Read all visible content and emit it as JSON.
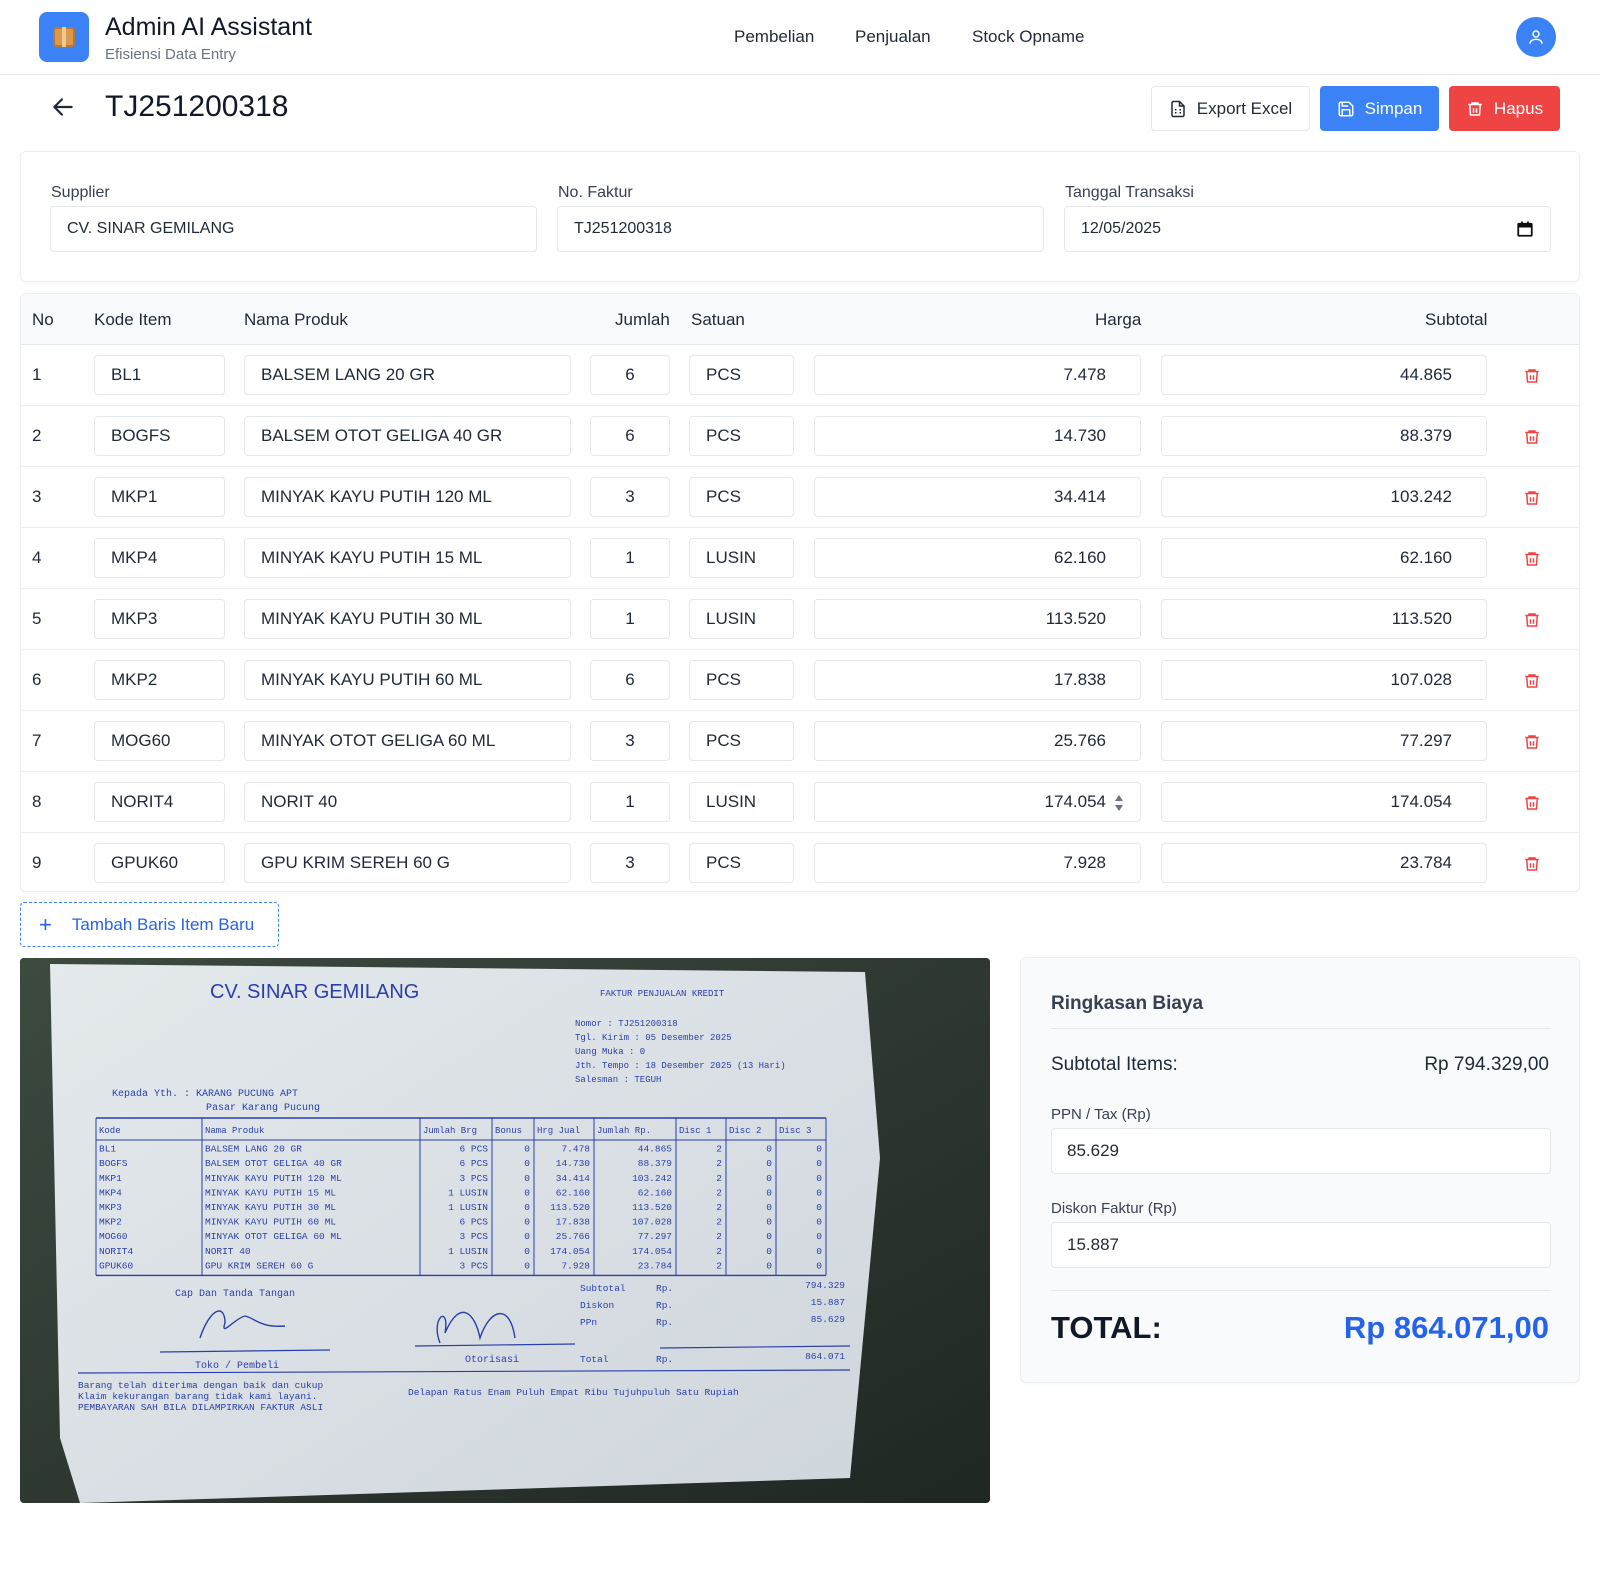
{
  "header": {
    "app_title": "Admin AI Assistant",
    "app_subtitle": "Efisiensi Data Entry",
    "nav": [
      "Pembelian",
      "Penjualan",
      "Stock Opname"
    ]
  },
  "page": {
    "title": "TJ251200318",
    "export_label": "Export Excel",
    "save_label": "Simpan",
    "delete_label": "Hapus"
  },
  "form": {
    "supplier_label": "Supplier",
    "supplier_value": "CV. SINAR GEMILANG",
    "faktur_label": "No. Faktur",
    "faktur_value": "TJ251200318",
    "tanggal_label": "Tanggal Transaksi",
    "tanggal_value": "12/05/2025"
  },
  "table": {
    "headers": {
      "no": "No",
      "kode": "Kode Item",
      "nama": "Nama Produk",
      "jumlah": "Jumlah",
      "satuan": "Satuan",
      "harga": "Harga",
      "subtotal": "Subtotal"
    },
    "rows": [
      {
        "no": "1",
        "kode": "BL1",
        "nama": "BALSEM LANG 20 GR",
        "jumlah": "6",
        "satuan": "PCS",
        "harga": "7.478",
        "subtotal": "44.865"
      },
      {
        "no": "2",
        "kode": "BOGFS",
        "nama": "BALSEM OTOT GELIGA 40 GR",
        "jumlah": "6",
        "satuan": "PCS",
        "harga": "14.730",
        "subtotal": "88.379"
      },
      {
        "no": "3",
        "kode": "MKP1",
        "nama": "MINYAK KAYU PUTIH 120 ML",
        "jumlah": "3",
        "satuan": "PCS",
        "harga": "34.414",
        "subtotal": "103.242"
      },
      {
        "no": "4",
        "kode": "MKP4",
        "nama": "MINYAK KAYU PUTIH 15 ML",
        "jumlah": "1",
        "satuan": "LUSIN",
        "harga": "62.160",
        "subtotal": "62.160"
      },
      {
        "no": "5",
        "kode": "MKP3",
        "nama": "MINYAK KAYU PUTIH 30 ML",
        "jumlah": "1",
        "satuan": "LUSIN",
        "harga": "113.520",
        "subtotal": "113.520"
      },
      {
        "no": "6",
        "kode": "MKP2",
        "nama": "MINYAK KAYU PUTIH 60 ML",
        "jumlah": "6",
        "satuan": "PCS",
        "harga": "17.838",
        "subtotal": "107.028"
      },
      {
        "no": "7",
        "kode": "MOG60",
        "nama": "MINYAK OTOT GELIGA 60 ML",
        "jumlah": "3",
        "satuan": "PCS",
        "harga": "25.766",
        "subtotal": "77.297"
      },
      {
        "no": "8",
        "kode": "NORIT4",
        "nama": "NORIT 40",
        "jumlah": "1",
        "satuan": "LUSIN",
        "harga": "174.054",
        "subtotal": "174.054"
      },
      {
        "no": "9",
        "kode": "GPUK60",
        "nama": "GPU KRIM SEREH 60 G",
        "jumlah": "3",
        "satuan": "PCS",
        "harga": "7.928",
        "subtotal": "23.784"
      }
    ],
    "add_row_label": "Tambah Baris Item Baru"
  },
  "invoice_photo": {
    "company": "CV. SINAR GEMILANG",
    "doc_type": "FAKTUR PENJUALAN KREDIT",
    "meta": [
      "Nomor : TJ251200318",
      "Tgl. Kirim : 05 Desember 2025",
      "Uang Muka : 0",
      "Jth. Tempo : 18 Desember 2025 (13 Hari)",
      "Salesman : TEGUH"
    ],
    "to_line1": "Kepada Yth. : KARANG PUCUNG APT",
    "to_line2": "Pasar Karang Pucung",
    "headers": [
      "Kode",
      "Nama Produk",
      "Jumlah Brg",
      "Bonus",
      "Hrg Jual",
      "Jumlah Rp.",
      "Disc 1",
      "Disc 2",
      "Disc 3"
    ],
    "rows": [
      [
        "BL1",
        "BALSEM LANG 20 GR",
        "6 PCS",
        "0",
        "7.478",
        "44.865",
        "2",
        "0",
        "0"
      ],
      [
        "BOGFS",
        "BALSEM OTOT GELIGA 40 GR",
        "6 PCS",
        "0",
        "14.730",
        "88.379",
        "2",
        "0",
        "0"
      ],
      [
        "MKP1",
        "MINYAK KAYU PUTIH 120 ML",
        "3 PCS",
        "0",
        "34.414",
        "103.242",
        "2",
        "0",
        "0"
      ],
      [
        "MKP4",
        "MINYAK KAYU PUTIH 15 ML",
        "1 LUSIN",
        "0",
        "62.160",
        "62.160",
        "2",
        "0",
        "0"
      ],
      [
        "MKP3",
        "MINYAK KAYU PUTIH 30 ML",
        "1 LUSIN",
        "0",
        "113.520",
        "113.520",
        "2",
        "0",
        "0"
      ],
      [
        "MKP2",
        "MINYAK KAYU PUTIH 60 ML",
        "6 PCS",
        "0",
        "17.838",
        "107.028",
        "2",
        "0",
        "0"
      ],
      [
        "MOG60",
        "MINYAK OTOT GELIGA 60 ML",
        "3 PCS",
        "0",
        "25.766",
        "77.297",
        "2",
        "0",
        "0"
      ],
      [
        "NORIT4",
        "NORIT 40",
        "1 LUSIN",
        "0",
        "174.054",
        "174.054",
        "2",
        "0",
        "0"
      ],
      [
        "GPUK60",
        "GPU KRIM SEREH 60 G",
        "3 PCS",
        "0",
        "7.928",
        "23.784",
        "2",
        "0",
        "0"
      ]
    ],
    "sign_label": "Cap Dan Tanda Tangan",
    "toko_label": "Toko / Pembeli",
    "otorisasi_label": "Otorisasi",
    "totals": [
      {
        "label": "Subtotal",
        "rp": "Rp.",
        "value": "794.329"
      },
      {
        "label": "Diskon",
        "rp": "Rp.",
        "value": "15.887"
      },
      {
        "label": "PPn",
        "rp": "Rp.",
        "value": "85.629"
      },
      {
        "label": "Total",
        "rp": "Rp.",
        "value": "864.071"
      }
    ],
    "note": [
      "Barang telah diterima dengan baik dan cukup",
      "Klaim kekurangan barang tidak kami layani.",
      "PEMBAYARAN SAH BILA DILAMPIRKAN FAKTUR ASLI"
    ],
    "terbilang": "Delapan Ratus Enam Puluh Empat Ribu Tujuhpuluh Satu Rupiah"
  },
  "summary": {
    "title": "Ringkasan Biaya",
    "subtotal_label": "Subtotal Items:",
    "subtotal_value": "Rp 794.329,00",
    "ppn_label": "PPN / Tax (Rp)",
    "ppn_value": "85.629",
    "diskon_label": "Diskon Faktur (Rp)",
    "diskon_value": "15.887",
    "total_label": "TOTAL:",
    "total_value": "Rp 864.071,00"
  },
  "colors": {
    "primary": "#3b82f6",
    "danger": "#ef4444",
    "total_accent": "#2563eb"
  }
}
